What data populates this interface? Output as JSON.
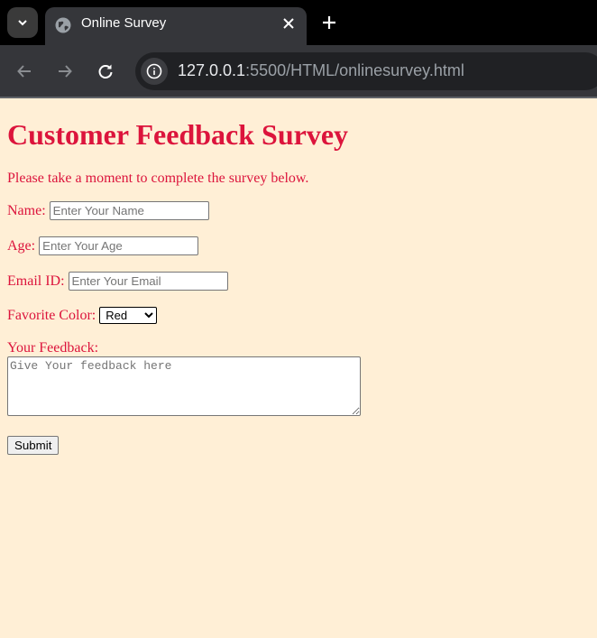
{
  "browser": {
    "tab_title": "Online Survey",
    "url_host": "127.0.0.1",
    "url_rest": ":5500/HTML/onlinesurvey.html"
  },
  "page": {
    "heading": "Customer Feedback Survey",
    "intro": "Please take a moment to complete the survey below.",
    "name_label": "Name:",
    "name_placeholder": "Enter Your Name",
    "age_label": "Age:",
    "age_placeholder": "Enter Your Age",
    "email_label": "Email ID:",
    "email_placeholder": "Enter Your Email",
    "color_label": "Favorite Color:",
    "color_selected": "Red",
    "feedback_label": "Your Feedback:",
    "feedback_placeholder": "Give Your feedback here",
    "submit_label": "Submit"
  },
  "colors": {
    "page_background": "#ffefd6",
    "text_accent": "#dc143c"
  }
}
